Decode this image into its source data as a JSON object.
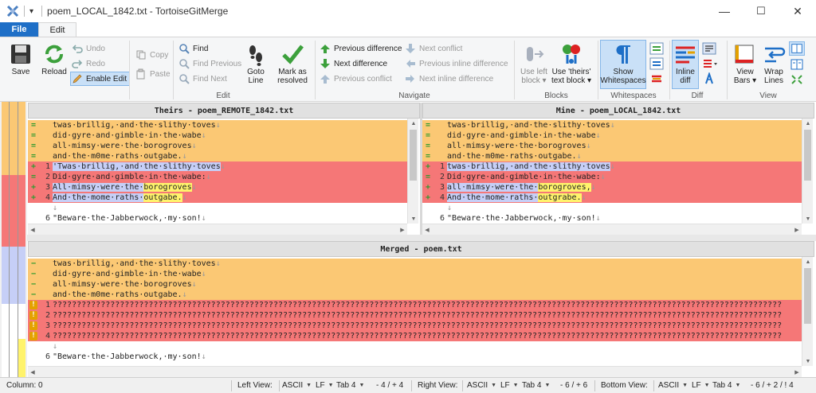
{
  "window": {
    "title": "poem_LOCAL_1842.txt - TortoiseGitMerge",
    "minimize": "—",
    "maximize": "☐",
    "close": "✕"
  },
  "tabs": {
    "file": "File",
    "edit": "Edit"
  },
  "ribbon": {
    "save": "Save",
    "reload": "Reload",
    "undo": "Undo",
    "redo": "Redo",
    "enable_edit": "Enable Edit",
    "copy": "Copy",
    "paste": "Paste",
    "find": "Find",
    "find_previous": "Find Previous",
    "find_next": "Find Next",
    "goto_line_1": "Goto",
    "goto_line_2": "Line",
    "mark_resolved_1": "Mark as",
    "mark_resolved_2": "resolved",
    "previous_difference": "Previous difference",
    "next_difference": "Next difference",
    "previous_conflict": "Previous conflict",
    "next_conflict": "Next conflict",
    "previous_inline_difference": "Previous inline difference",
    "next_inline_difference": "Next inline difference",
    "use_left_block_1": "Use left",
    "use_left_block_2": "block ▾",
    "use_theirs_block_1": "Use 'theirs'",
    "use_theirs_block_2": "text block ▾",
    "show_whitespaces_1": "Show",
    "show_whitespaces_2": "Whitespaces",
    "inline_diff_1": "Inline",
    "inline_diff_2": "diff",
    "view_bars_1": "View",
    "view_bars_2": "Bars ▾",
    "wrap_lines_1": "Wrap",
    "wrap_lines_2": "Lines",
    "groups": {
      "edit": "Edit",
      "navigate": "Navigate",
      "blocks": "Blocks",
      "whitespaces": "Whitespaces",
      "diff": "Diff",
      "view": "View"
    }
  },
  "colors": {
    "orange": "#fbc874",
    "red": "#f57777",
    "blue_highlight": "#c6cff7",
    "yellow_highlight": "#fff36c",
    "file_tab": "#1e6fc7"
  },
  "theirs": {
    "title": "Theirs - poem_REMOTE_1842.txt",
    "lines": [
      {
        "marker": "=",
        "num": "",
        "text": "twas·brillig,·and·the·slithy·toves",
        "eol": "↓",
        "bg": "orange"
      },
      {
        "marker": "=",
        "num": "",
        "text": "did·gyre·and·gimble·in·the·wabe",
        "eol": "↓",
        "bg": "orange"
      },
      {
        "marker": "=",
        "num": "",
        "text": "all·mimsy·were·the·borogroves",
        "eol": "↓",
        "bg": "orange"
      },
      {
        "marker": "=",
        "num": "",
        "text": "and·the·m0me·raths·outgabe.",
        "eol": "↓",
        "bg": "orange"
      },
      {
        "marker": "+",
        "num": "1",
        "text": "'Twas·brillig,·and·the·slithy·toves",
        "eol": "↓",
        "bg": "red",
        "hl": "blue"
      },
      {
        "marker": "=",
        "num": "2",
        "text": "Did·gyre·and·gimble·in·the·wabe:",
        "eol": "↓",
        "bg": "red"
      },
      {
        "marker": "+",
        "num": "3",
        "text": "All·mimsy·were·the·borogroves",
        "eol": "↓",
        "bg": "red",
        "hl": "blue"
      },
      {
        "marker": "+",
        "num": "4",
        "text": "And·the·mome·raths·outgabe.",
        "eol": "↓",
        "bg": "red",
        "hl": "blue"
      },
      {
        "marker": "",
        "num": "",
        "text": "",
        "eol": "↓",
        "bg": "white"
      },
      {
        "marker": "",
        "num": "6",
        "text": "\"Beware·the·Jabberwock,·my·son!",
        "eol": "↓",
        "bg": "white"
      }
    ]
  },
  "mine": {
    "title": "Mine - poem_LOCAL_1842.txt",
    "lines": [
      {
        "marker": "=",
        "num": "",
        "text": "twas·brillig,·and·the·slithy·toves",
        "eol": "↓",
        "bg": "orange"
      },
      {
        "marker": "=",
        "num": "",
        "text": "did·gyre·and·gimble·in·the·wabe",
        "eol": "↓",
        "bg": "orange"
      },
      {
        "marker": "=",
        "num": "",
        "text": "all·mimsy·were·the·borogroves",
        "eol": "↓",
        "bg": "orange"
      },
      {
        "marker": "=",
        "num": "",
        "text": "and·the·m0me·raths·outgabe.",
        "eol": "↓",
        "bg": "orange"
      },
      {
        "marker": "+",
        "num": "1",
        "text": "twas·brillig,·and·the·slithy·toves",
        "eol": "↓",
        "bg": "red",
        "hl": "blue"
      },
      {
        "marker": "=",
        "num": "2",
        "text": "Did·gyre·and·gimble·in·the·wabe:",
        "eol": "↓",
        "bg": "red"
      },
      {
        "marker": "+",
        "num": "3",
        "text": "all·mimsy·were·the·borogroves,",
        "eol": "↓",
        "bg": "red",
        "hl": "blue"
      },
      {
        "marker": "+",
        "num": "4",
        "text": "And·the·mome·raths·outgrabe.",
        "eol": "↓",
        "bg": "red",
        "hl": "blue"
      },
      {
        "marker": "",
        "num": "",
        "text": "",
        "eol": "↓",
        "bg": "white"
      },
      {
        "marker": "",
        "num": "6",
        "text": "\"Beware·the·Jabberwock,·my·son!",
        "eol": "↓",
        "bg": "white"
      }
    ]
  },
  "merged": {
    "title": "Merged - poem.txt",
    "lines": [
      {
        "marker": "−",
        "num": "",
        "text": "twas·brillig,·and·the·slithy·toves",
        "eol": "↓",
        "bg": "orange"
      },
      {
        "marker": "−",
        "num": "",
        "text": "did·gyre·and·gimble·in·the·wabe",
        "eol": "↓",
        "bg": "orange"
      },
      {
        "marker": "−",
        "num": "",
        "text": "all·mimsy·were·the·borogroves",
        "eol": "↓",
        "bg": "orange"
      },
      {
        "marker": "−",
        "num": "",
        "text": "and·the·m0me·raths·outgabe.",
        "eol": "↓",
        "bg": "orange"
      },
      {
        "marker": "!",
        "num": "1",
        "text": "????????????????????????????????????????????????????????????????????????????????????????????????????????????????????????????????????????????????????????",
        "eol": "",
        "bg": "red"
      },
      {
        "marker": "!",
        "num": "2",
        "text": "????????????????????????????????????????????????????????????????????????????????????????????????????????????????????????????????????????????????????????",
        "eol": "",
        "bg": "red"
      },
      {
        "marker": "!",
        "num": "3",
        "text": "????????????????????????????????????????????????????????????????????????????????????????????????????????????????????????????????????????????????????????",
        "eol": "",
        "bg": "red"
      },
      {
        "marker": "!",
        "num": "4",
        "text": "????????????????????????????????????????????????????????????????????????????????????????????????????????????????????????????????????????????????????????",
        "eol": "",
        "bg": "red"
      },
      {
        "marker": "",
        "num": "",
        "text": "",
        "eol": "↓",
        "bg": "white"
      },
      {
        "marker": "",
        "num": "6",
        "text": "\"Beware·the·Jabberwock,·my·son!",
        "eol": "↓",
        "bg": "white"
      }
    ]
  },
  "status": {
    "column": "Column: 0",
    "left_view_label": "Left View:",
    "left_encoding": "ASCII",
    "left_eol": "LF",
    "left_tab": "Tab 4",
    "left_counts": "- 4 / + 4",
    "right_view_label": "Right View:",
    "right_encoding": "ASCII",
    "right_eol": "LF",
    "right_tab": "Tab 4",
    "right_counts": "- 6 / + 6",
    "bottom_view_label": "Bottom View:",
    "bottom_encoding": "ASCII",
    "bottom_eol": "LF",
    "bottom_tab": "Tab 4",
    "bottom_counts": "- 6 / + 2 / ! 4"
  }
}
